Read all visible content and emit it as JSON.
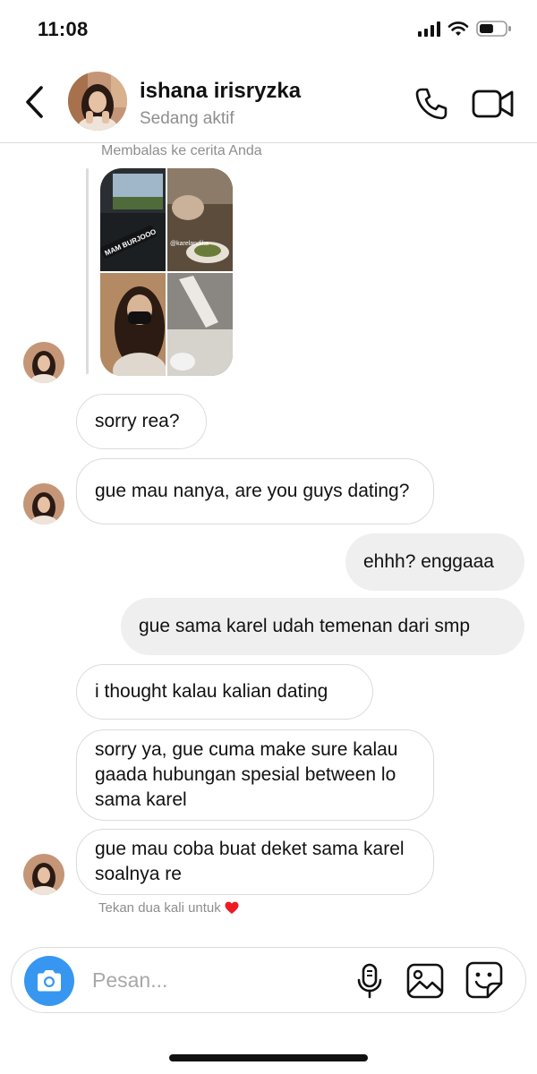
{
  "status_bar": {
    "time": "11:08",
    "battery_level": 0.55
  },
  "header": {
    "name": "ishana irisryzka",
    "status": "Sedang aktif"
  },
  "story_reply": {
    "label": "Membalas ke cerita Anda",
    "caption": "MAM BURJOOO",
    "tag": "@karelandika"
  },
  "messages": [
    {
      "sender": "them",
      "text": "sorry rea?"
    },
    {
      "sender": "them",
      "text": "gue mau nanya, are you guys dating?"
    },
    {
      "sender": "me",
      "text": "ehhh? enggaaa"
    },
    {
      "sender": "me",
      "text": "gue sama karel udah temenan dari smp"
    },
    {
      "sender": "them",
      "text": "i thought kalau kalian dating"
    },
    {
      "sender": "them",
      "text": "sorry ya, gue cuma make sure kalau gaada hubungan spesial between lo sama karel"
    },
    {
      "sender": "them",
      "text": "gue mau coba buat deket sama karel soalnya re"
    }
  ],
  "tap_hint": "Tekan dua kali untuk",
  "composer": {
    "placeholder": "Pesan..."
  },
  "colors": {
    "accent": "#3797f0",
    "outgoing_bubble": "#efefef",
    "incoming_border": "#dbdbdb",
    "secondary_text": "#8e8e8e",
    "heart": "#ed1c24"
  },
  "icons": [
    "back-chevron",
    "phone",
    "video-camera",
    "camera",
    "microphone",
    "gallery",
    "sticker",
    "heart"
  ]
}
